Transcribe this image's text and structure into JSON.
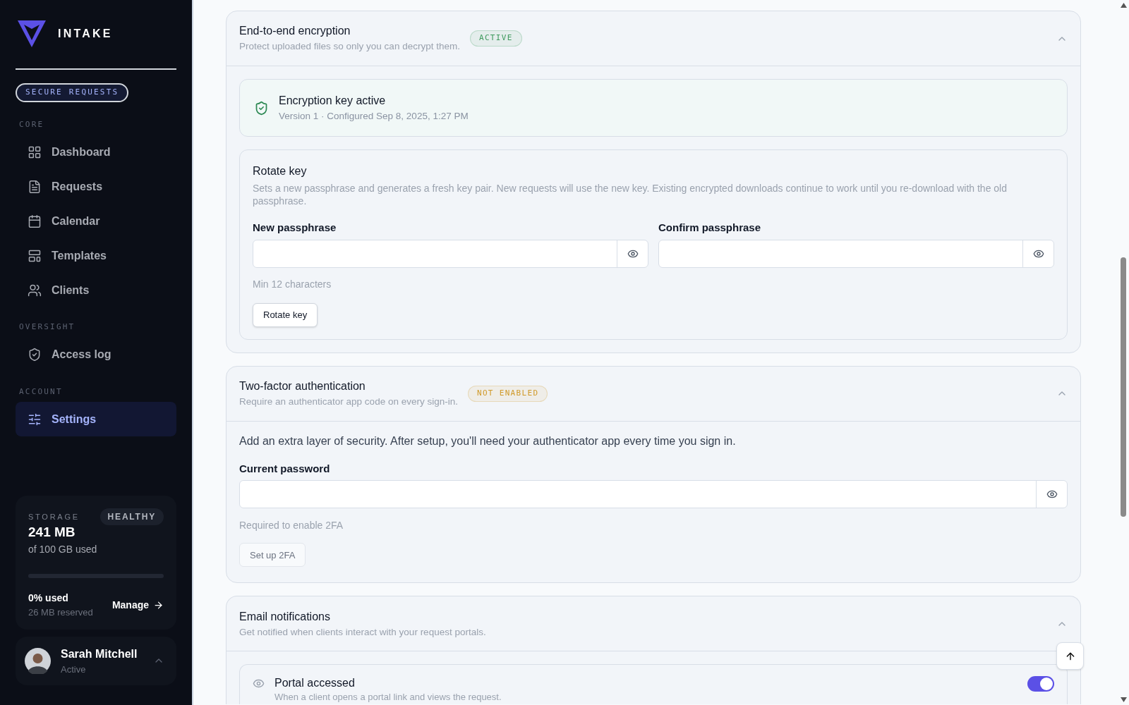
{
  "brand": {
    "name": "INTAKE",
    "tagline": "SECURE REQUESTS"
  },
  "nav_groups": [
    {
      "label": "CORE",
      "items": [
        {
          "label": "Dashboard",
          "selected": false
        },
        {
          "label": "Requests",
          "selected": false
        },
        {
          "label": "Calendar",
          "selected": false
        },
        {
          "label": "Templates",
          "selected": false
        },
        {
          "label": "Clients",
          "selected": false
        }
      ]
    },
    {
      "label": "OVERSIGHT",
      "items": [
        {
          "label": "Access log",
          "selected": false
        }
      ]
    },
    {
      "label": "ACCOUNT",
      "items": [
        {
          "label": "Settings",
          "selected": true
        }
      ]
    }
  ],
  "storage": {
    "label": "STORAGE",
    "status": "HEALTHY",
    "amount": "241 MB",
    "of": "of 100 GB used",
    "level": 0,
    "percent": "0% used",
    "reserved": "26 MB reserved",
    "action": "Manage"
  },
  "user": {
    "name": "Sarah Mitchell",
    "status": "Active"
  },
  "sections": [
    {
      "kind": "encryption",
      "title": "End-to-end encryption",
      "description": "Protect uploaded files so only you can decrypt them.",
      "badge": {
        "text": "ACTIVE",
        "color": "#3f9a5e"
      },
      "expanded": true,
      "key_status": {
        "title": "Encryption key active",
        "detail": "Version 1 · Configured Sep 8, 2025, 1:27 PM"
      },
      "rotate": {
        "title": "Rotate key",
        "description": "Sets a new passphrase and generates a fresh key pair. New requests will use the new key. Existing encrypted downloads continue to work until you re-download with the old passphrase.",
        "fields": [
          {
            "label": "New passphrase"
          },
          {
            "label": "Confirm passphrase"
          }
        ],
        "hint": "Min 12 characters",
        "button": {
          "label": "Rotate key",
          "disabled": false
        }
      }
    },
    {
      "kind": "twofactor",
      "title": "Two-factor authentication",
      "description": "Require an authenticator app code on every sign-in.",
      "badge": {
        "text": "NOT ENABLED",
        "color": "#d09a2a"
      },
      "expanded": true,
      "intro": "Add an extra layer of security. After setup, you'll need your authenticator app every time you sign in.",
      "field": {
        "label": "Current password"
      },
      "hint": "Required to enable 2FA",
      "button": {
        "label": "Set up 2FA",
        "disabled": true
      }
    },
    {
      "kind": "notifications",
      "title": "Email notifications",
      "description": "Get notified when clients interact with your request portals.",
      "expanded": true,
      "items": [
        {
          "title": "Portal accessed",
          "description": "When a client opens a portal link and views the request.",
          "on": true
        }
      ]
    }
  ]
}
